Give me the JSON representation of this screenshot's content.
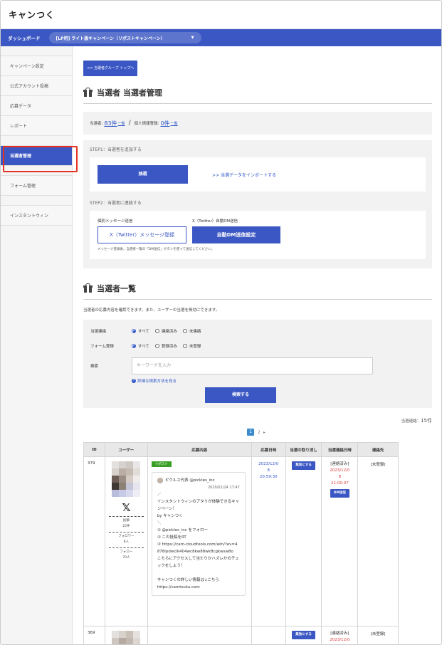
{
  "app": {
    "logo": "キャンつく"
  },
  "navbar": {
    "dashboard": "ダッシュボード",
    "campaign": "[LP用] ライト版キャンペーン（リポストキャンペーン）"
  },
  "sidebar": {
    "items": [
      {
        "label": "キャンペーン設定"
      },
      {
        "label": "公式アカウント投稿"
      },
      {
        "label": "応募データ"
      },
      {
        "label": "レポート"
      },
      {
        "label": "当選者管理"
      },
      {
        "label": "フォーム管理"
      },
      {
        "label": "インスタントウィン"
      }
    ]
  },
  "main": {
    "back_button": "<< 当選者グループ トップへ",
    "title_management": "当選者 当選者管理",
    "stats": {
      "winners_label": "当選者:",
      "winners_count": "83件",
      "winners_link": "一覧",
      "slash": "/",
      "personal_label": "個人情報登録:",
      "personal_count": "0件",
      "personal_link": "一覧"
    },
    "step1": {
      "label": "STEP1：当選者を追加する",
      "lottery_button": "抽選",
      "import_link": ">> 当選データをインポートする"
    },
    "step2": {
      "label": "STEP2：当選者に連絡する",
      "individual_label": "個別メッセージ送信",
      "auto_dm_label": "X（Twitter）自動DM送信",
      "message_button": "X（Twitter）メッセージ登録",
      "auto_dm_button": "自動DM送信設定",
      "note": "メッセージ登録後、当選者一覧の「DM送信」ボタンを使って送信してください。"
    },
    "title_list": "当選者一覧",
    "list_desc": "当選者の応募内容を確認できます。また、ユーザーの当選を無効にできます。",
    "filter": {
      "contact_label": "当選連絡",
      "contact_options": [
        "すべて",
        "連絡済み",
        "未連絡"
      ],
      "form_label": "フォーム登録",
      "form_options": [
        "すべて",
        "登録済み",
        "未登録"
      ],
      "keyword_label": "検索",
      "keyword_placeholder": "キーワードを入力",
      "help_link": "詳細な検索方法を見る",
      "search_button": "検索する"
    },
    "count": {
      "label": "当選連絡：",
      "value": "15件"
    },
    "pager": {
      "current": "1",
      "next": "2",
      "arrow": "▸"
    },
    "table": {
      "headers": [
        "ID",
        "ユーザー",
        "応募内容",
        "応募日時",
        "当選の取り消し",
        "当選連絡日時",
        "連絡先"
      ],
      "rows": [
        {
          "id": "379",
          "posts_label": "投稿",
          "posts": "25件",
          "following_label": "フォロワー",
          "following": "8人",
          "followers_label": "フォロー",
          "followers": "70人",
          "tag": "リポスト",
          "tweet_user": "ピクルス代表 @pickles_inc",
          "tweet_date": "2020/01/24 17:47",
          "tweet_lines": [
            "／",
            "インスタントウィンのアタリが体験できるキャンペーン！",
            "by キャンつく",
            "＼",
            "① @pickles_inc をフォロー",
            "② この投稿をRT",
            "③ https://cam-cloudtools.com/win/?ev=4878ipdwclk404wc8kw88wk8cgkwsw8o",
            "こちらにアクセスして当たりかハズレかのチェックをしよう！",
            "",
            "キャンつくの詳しい情報は↓こちら",
            "https://camtsuku.com"
          ],
          "date_line1": "2023/12/0",
          "date_line2": "8",
          "date_line3": "20:59:30",
          "cancel_button": "無効にする",
          "contact_status": "[連絡済み]",
          "contact_line1": "2023/12/0",
          "contact_line2": "8",
          "contact_line3": "21:00:07",
          "dm_button": "DM送信",
          "contact_info": "[未登録]"
        },
        {
          "id": "369",
          "cancel_button": "無効にする",
          "contact_status": "[連絡済み]",
          "contact_line1": "2023/12/0",
          "contact_info": "[未登録]"
        }
      ]
    }
  },
  "colors": {
    "primary": "#3b57c4",
    "highlight": "#e53222",
    "tag_green": "#3aa025",
    "link": "#2f56c9",
    "alert_red": "#e23b3b"
  }
}
